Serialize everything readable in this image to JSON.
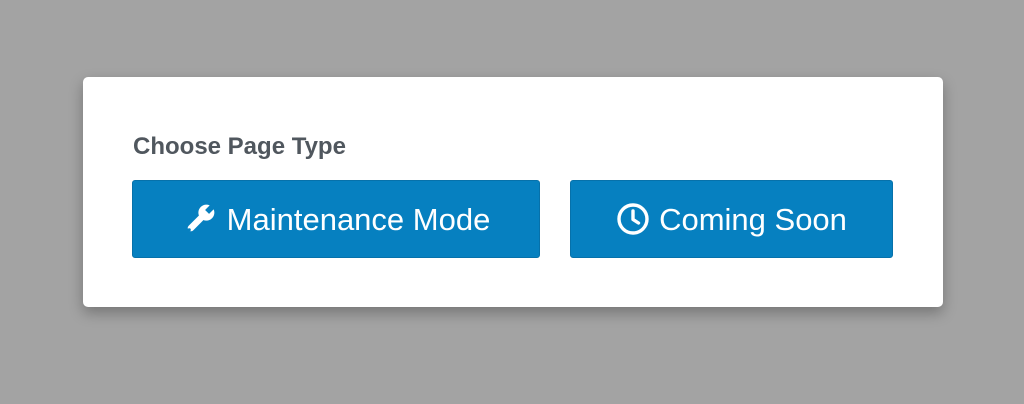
{
  "dialog": {
    "heading": "Choose Page Type",
    "options": [
      {
        "label": "Maintenance Mode",
        "icon": "wrench-icon"
      },
      {
        "label": "Coming Soon",
        "icon": "clock-icon"
      }
    ]
  },
  "colors": {
    "backdrop": "#a3a3a3",
    "card": "#ffffff",
    "heading_text": "#50575e",
    "button_bg": "#0680c0",
    "button_text": "#ffffff"
  }
}
